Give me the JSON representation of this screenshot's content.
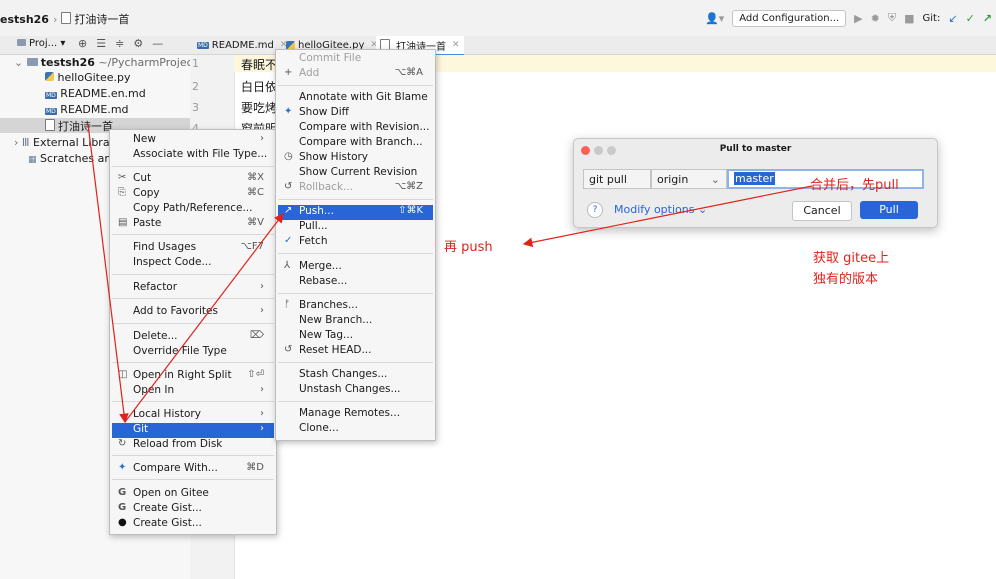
{
  "nav": {
    "project": "estsh26",
    "file": "打油诗一首",
    "add_configuration": "Add Configuration...",
    "git_label": "Git:"
  },
  "tool": {
    "project_label": "Proj...",
    "tabs": [
      {
        "label": "README.md",
        "badge": "MD"
      },
      {
        "label": "helloGitee.py"
      },
      {
        "label": "打油诗一首"
      }
    ]
  },
  "tree": {
    "root_name": "testsh26",
    "root_path": "~/PycharmProjects",
    "files": [
      "helloGitee.py",
      "README.en.md",
      "README.md",
      "打油诗一首"
    ],
    "external": "External Libra",
    "scratches": "Scratches an"
  },
  "editor": {
    "line_numbers": [
      "1",
      "2",
      "3",
      "4"
    ],
    "lines": [
      "春眠不",
      "白日依",
      "要吃烤",
      "窗前明"
    ]
  },
  "menu1": {
    "items": [
      {
        "label": "New",
        "icon": "",
        "shortcut": "",
        "arrow": true
      },
      {
        "label": "Associate with File Type...",
        "icon": "",
        "shortcut": ""
      },
      {
        "label": "Cut",
        "icon": "✂",
        "shortcut": "⌘X"
      },
      {
        "label": "Copy",
        "icon": "⎘",
        "shortcut": "⌘C"
      },
      {
        "label": "Copy Path/Reference...",
        "icon": "",
        "shortcut": ""
      },
      {
        "label": "Paste",
        "icon": "▤",
        "shortcut": "⌘V"
      },
      {
        "label": "Find Usages",
        "icon": "",
        "shortcut": "⌥F7"
      },
      {
        "label": "Inspect Code...",
        "icon": "",
        "shortcut": ""
      },
      {
        "label": "Refactor",
        "icon": "",
        "shortcut": "",
        "arrow": true
      },
      {
        "label": "Add to Favorites",
        "icon": "",
        "shortcut": "",
        "arrow": true
      },
      {
        "label": "Delete...",
        "icon": "",
        "shortcut": "⌦"
      },
      {
        "label": "Override File Type",
        "icon": "",
        "shortcut": ""
      },
      {
        "label": "Open in Right Split",
        "icon": "◫",
        "shortcut": "⇧⏎"
      },
      {
        "label": "Open In",
        "icon": "",
        "shortcut": "",
        "arrow": true
      },
      {
        "label": "Local History",
        "icon": "",
        "shortcut": "",
        "arrow": true
      },
      {
        "label": "Git",
        "icon": "",
        "shortcut": "",
        "arrow": true
      },
      {
        "label": "Reload from Disk",
        "icon": "↻",
        "shortcut": ""
      },
      {
        "label": "Compare With...",
        "icon": "✦",
        "shortcut": "⌘D"
      },
      {
        "label": "Open on Gitee",
        "icon": "G",
        "shortcut": ""
      },
      {
        "label": "Create Gist...",
        "icon": "G",
        "shortcut": ""
      },
      {
        "label": "Create Gist...",
        "icon": "●",
        "shortcut": ""
      }
    ]
  },
  "menu2": {
    "items": [
      {
        "label": "Commit File",
        "icon": "",
        "shortcut": ""
      },
      {
        "label": "Add",
        "icon": "+",
        "shortcut": "⌥⌘A"
      },
      {
        "label": "Annotate with Git Blame",
        "icon": "",
        "shortcut": ""
      },
      {
        "label": "Show Diff",
        "icon": "✦",
        "shortcut": ""
      },
      {
        "label": "Compare with Revision...",
        "icon": "",
        "shortcut": ""
      },
      {
        "label": "Compare with Branch...",
        "icon": "",
        "shortcut": ""
      },
      {
        "label": "Show History",
        "icon": "◷",
        "shortcut": ""
      },
      {
        "label": "Show Current Revision",
        "icon": "",
        "shortcut": ""
      },
      {
        "label": "Rollback...",
        "icon": "↺",
        "shortcut": "⌥⌘Z"
      },
      {
        "label": "Push...",
        "icon": "↗",
        "shortcut": "⇧⌘K"
      },
      {
        "label": "Pull...",
        "icon": "",
        "shortcut": ""
      },
      {
        "label": "Fetch",
        "icon": "✓",
        "shortcut": ""
      },
      {
        "label": "Merge...",
        "icon": "⅄",
        "shortcut": ""
      },
      {
        "label": "Rebase...",
        "icon": "",
        "shortcut": ""
      },
      {
        "label": "Branches...",
        "icon": "ᚠ",
        "shortcut": ""
      },
      {
        "label": "New Branch...",
        "icon": "",
        "shortcut": ""
      },
      {
        "label": "New Tag...",
        "icon": "",
        "shortcut": ""
      },
      {
        "label": "Reset HEAD...",
        "icon": "↺",
        "shortcut": ""
      },
      {
        "label": "Stash Changes...",
        "icon": "",
        "shortcut": ""
      },
      {
        "label": "Unstash Changes...",
        "icon": "",
        "shortcut": ""
      },
      {
        "label": "Manage Remotes...",
        "icon": "",
        "shortcut": ""
      },
      {
        "label": "Clone...",
        "icon": "",
        "shortcut": ""
      }
    ]
  },
  "dialog": {
    "title": "Pull to master",
    "command": "git pull",
    "remote": "origin",
    "branch": "master",
    "modify_options": "Modify options",
    "cancel": "Cancel",
    "pull": "Pull"
  },
  "annotations": {
    "push_note": "再 push",
    "merge_note": "合并后，先pull",
    "fetch_note_line1": "获取 gitee上",
    "fetch_note_line2": "独有的版本"
  },
  "colors": {
    "selection": "#2965d7",
    "annotation": "#e0221a",
    "highlight_line": "#fdf8dc"
  }
}
